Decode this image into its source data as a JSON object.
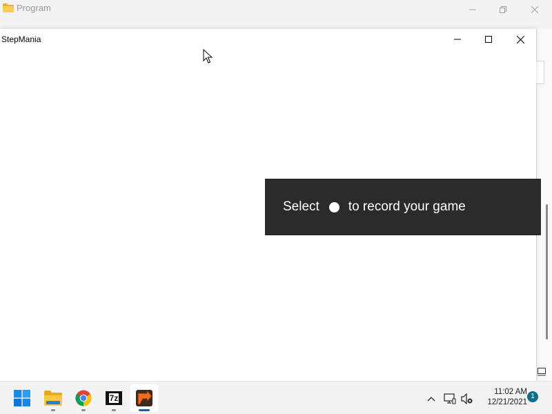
{
  "background_window": {
    "title": "Program",
    "icon": "folder-icon"
  },
  "app_window": {
    "title": "StepMania",
    "controls": {
      "minimize": "minimize-icon",
      "maximize": "maximize-icon",
      "close": "close-icon"
    }
  },
  "toast": {
    "text_before": "Select",
    "icon": "record-icon",
    "text_after": "to record your game"
  },
  "taskbar": {
    "apps": [
      {
        "name": "Start",
        "icon": "windows-start-icon"
      },
      {
        "name": "File Explorer",
        "icon": "file-explorer-icon",
        "running": true
      },
      {
        "name": "Google Chrome",
        "icon": "chrome-icon",
        "running": true
      },
      {
        "name": "7-Zip",
        "icon": "7zip-icon",
        "label": "7z",
        "running": true
      },
      {
        "name": "StepMania",
        "icon": "stepmania-icon",
        "active": true
      }
    ],
    "tray": {
      "overflow_icon": "chevron-up-icon",
      "network_icon": "network-icon",
      "volume_icon": "volume-muted-icon"
    },
    "clock": {
      "time": "11:02 AM",
      "date": "12/21/2021"
    },
    "notification_count": "1"
  },
  "colors": {
    "toast_bg": "#2b2b2b",
    "taskbar_bg": "#f3f3f3",
    "active_indicator": "#0067c0",
    "notification_badge": "#0f6e8c"
  }
}
